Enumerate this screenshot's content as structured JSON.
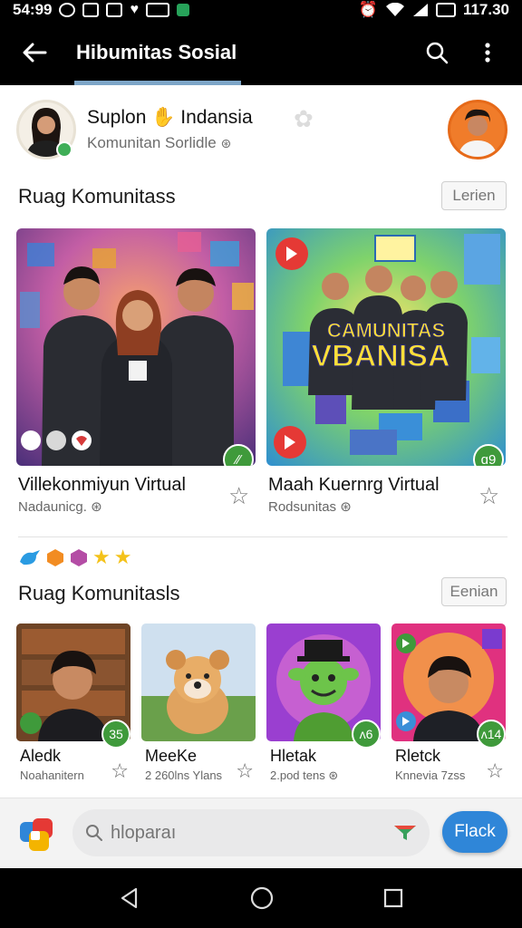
{
  "status_bar": {
    "left_text": "54:99",
    "right_time": "117.30",
    "icons": [
      "sync-icon",
      "download-icon",
      "notification-icon",
      "heart-icon",
      "app-icon",
      "android-icon",
      "alarm-icon",
      "wifi-icon",
      "signal-icon",
      "battery-icon"
    ]
  },
  "appbar": {
    "title": "Hibumitas Sosial",
    "icons": [
      "back-arrow-icon",
      "search-icon",
      "more-vert-icon"
    ]
  },
  "community": {
    "name": "Suplon",
    "name_suffix": "Indansia",
    "subtitle": "Komunitan Sorlidle"
  },
  "section1": {
    "title": "Ruag Komunitass",
    "button": "Lerien",
    "cards": [
      {
        "title": "Villekonmiyun Virtual",
        "subtitle": "Nadaunicg.",
        "badge": "⁄⁄",
        "overlay_text": ""
      },
      {
        "title": "Maah Kuernrg Virtual",
        "subtitle": "Rodsunitas",
        "badge": "ɑ9",
        "overlay_line1": "CAMUNITAS",
        "overlay_line2": "VBANISA"
      }
    ]
  },
  "section2": {
    "title": "Ruag Komunitasls",
    "button": "Eenian",
    "cards": [
      {
        "name": "Aledk",
        "subtitle": "Noahanitern",
        "badge": "35"
      },
      {
        "name": "MeeKe",
        "subtitle": "2 260lns Ylans",
        "badge": ""
      },
      {
        "name": "Hletak",
        "subtitle": "2.pod tens",
        "badge": "ᴧ6"
      },
      {
        "name": "Rletck",
        "subtitle": "Knnevia 7zss",
        "badge": "ᴧ14"
      }
    ]
  },
  "bottom": {
    "search_placeholder": "hloparaı",
    "action_label": "Flack"
  },
  "colors": {
    "accent": "#2f86d8",
    "badge_green": "#3f9a3b",
    "tab_indicator": "#7ea6c8"
  }
}
